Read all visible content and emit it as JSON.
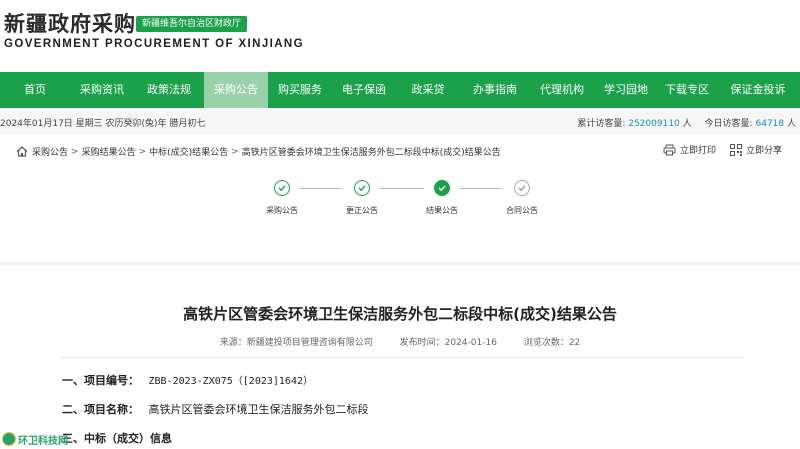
{
  "header": {
    "logo_cn": "新疆政府采购",
    "badge": "新疆维吾尔自治区财政厅",
    "logo_en": "GOVERNMENT PROCUREMENT OF XINJIANG"
  },
  "nav": {
    "items": [
      {
        "label": "首页"
      },
      {
        "label": "采购资讯"
      },
      {
        "label": "政策法规"
      },
      {
        "label": "采购公告"
      },
      {
        "label": "购买服务"
      },
      {
        "label": "电子保函"
      },
      {
        "label": "政采贷"
      },
      {
        "label": "办事指南"
      },
      {
        "label": "代理机构"
      },
      {
        "label": "学习园地"
      },
      {
        "label": "下载专区"
      },
      {
        "label": "保证金投诉"
      }
    ],
    "active_index": 3
  },
  "infobar": {
    "date": "2024年01月17日 星期三 农历癸卯(兔)年 腊月初七",
    "total_label": "累计访客量:",
    "total_value": "252009110",
    "total_unit": "人",
    "today_label": "今日访客量:",
    "today_value": "64718",
    "today_unit": "人"
  },
  "breadcrumb": {
    "items": [
      "采购公告",
      "采购结果公告",
      "中标(成交)结果公告",
      "高铁片区管委会环境卫生保洁服务外包二标段中标(成交)结果公告"
    ],
    "sep": ">"
  },
  "tools": {
    "print": "立即打印",
    "share": "立即分享"
  },
  "steps": [
    {
      "label": "采购公告",
      "state": "done"
    },
    {
      "label": "更正公告",
      "state": "done"
    },
    {
      "label": "结果公告",
      "state": "active"
    },
    {
      "label": "合同公告",
      "state": "pending"
    }
  ],
  "document": {
    "title": "高铁片区管委会环境卫生保洁服务外包二标段中标(成交)结果公告",
    "source": "来源：新疆建投项目管理咨询有限公司",
    "published": "发布时间：2024-01-16",
    "views": "浏览次数：22",
    "sections": [
      {
        "head": "一、项目编号：",
        "value": "ZBB-2023-ZX075（[2023]1642）"
      },
      {
        "head": "二、项目名称：",
        "value": "高铁片区管委会环境卫生保洁服务外包二标段"
      },
      {
        "head": "三、中标（成交）信息",
        "value": ""
      }
    ]
  },
  "watermark": "环卫科技网",
  "colors": {
    "brand_green": "#1aa14a",
    "nav_active": "#9bd1aa",
    "counter_blue": "#1a8fbf"
  }
}
